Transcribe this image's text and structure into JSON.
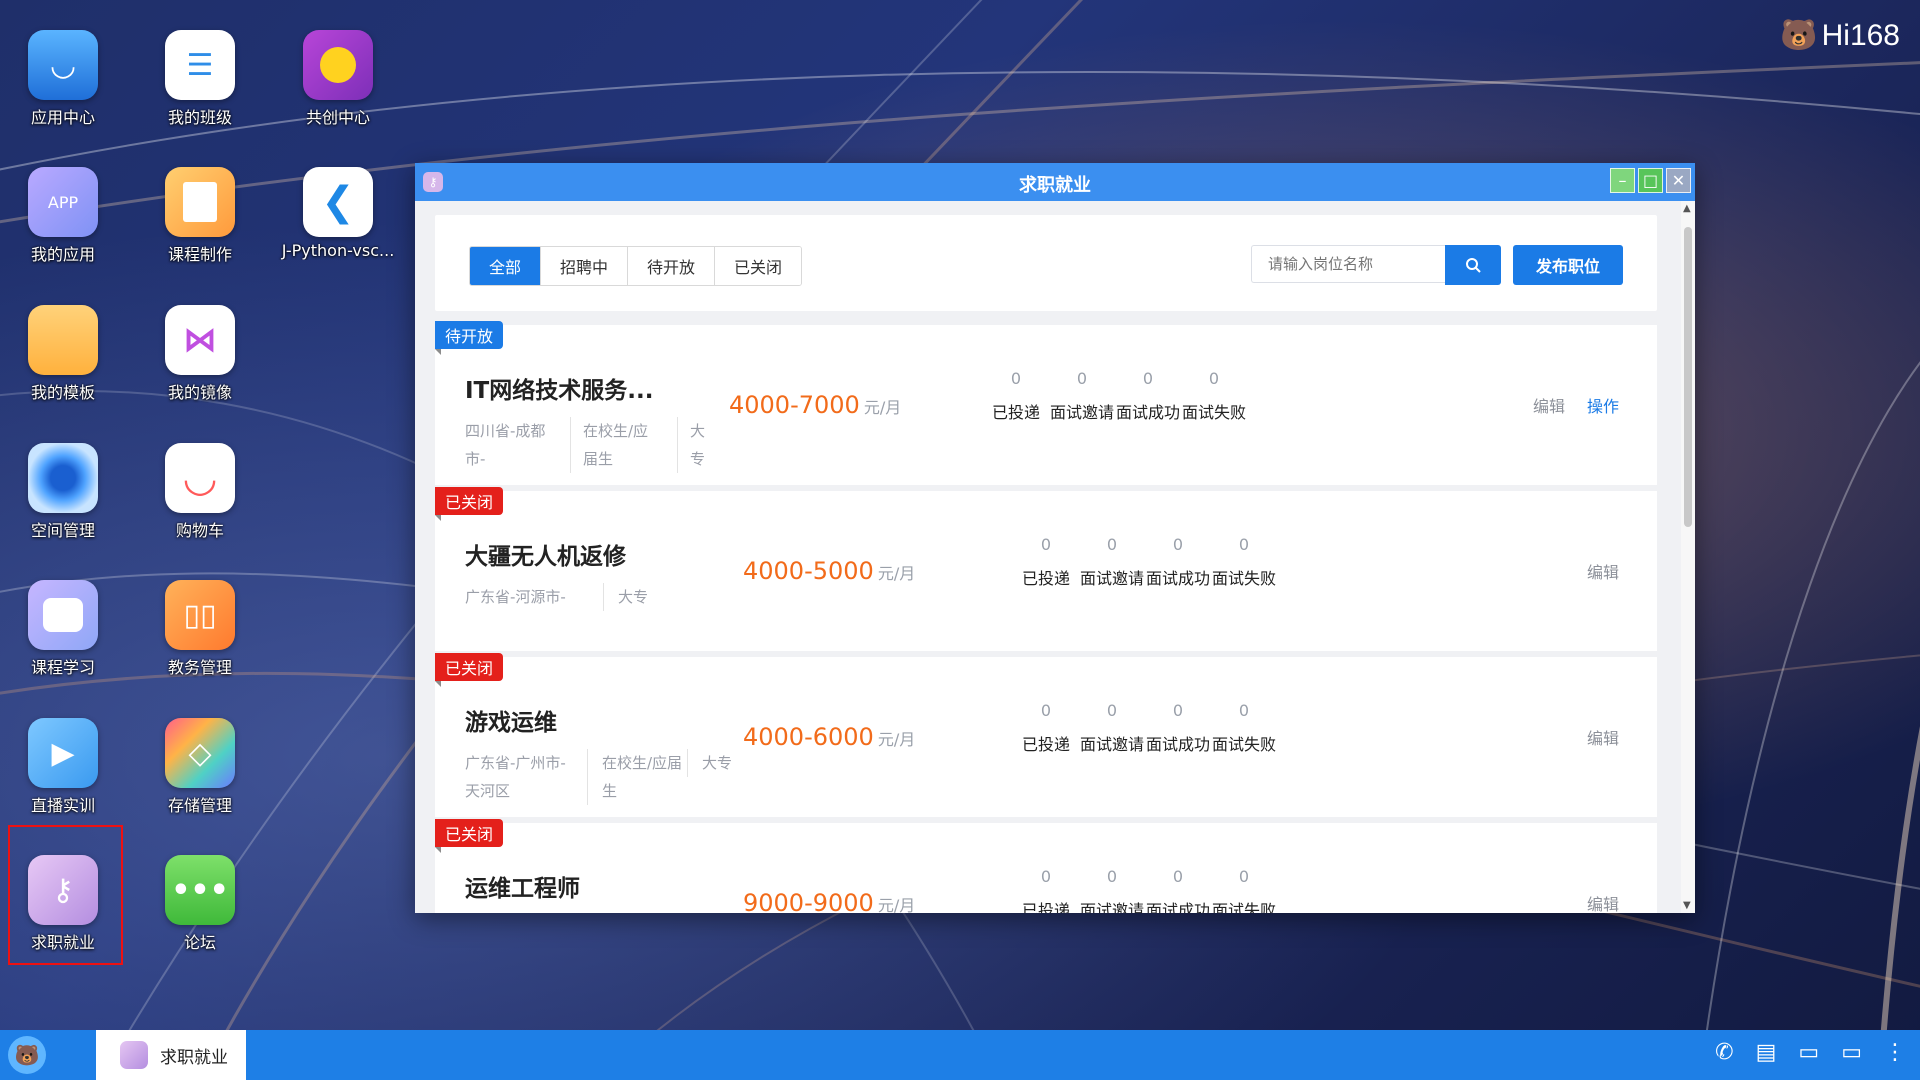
{
  "brand": {
    "text": "Hi168"
  },
  "desktop": {
    "icons": [
      {
        "label": "应用中心"
      },
      {
        "label": "我的班级"
      },
      {
        "label": "共创中心"
      },
      {
        "label": "我的应用",
        "badge": "APP"
      },
      {
        "label": "课程制作"
      },
      {
        "label": "J-Python-vsc..."
      },
      {
        "label": "我的模板"
      },
      {
        "label": "我的镜像"
      },
      {
        "label": "空间管理"
      },
      {
        "label": "购物车"
      },
      {
        "label": "课程学习"
      },
      {
        "label": "教务管理"
      },
      {
        "label": "直播实训"
      },
      {
        "label": "存储管理"
      },
      {
        "label": "求职就业"
      },
      {
        "label": "论坛"
      }
    ]
  },
  "window": {
    "title": "求职就业",
    "tabs": [
      {
        "label": "全部",
        "active": true
      },
      {
        "label": "招聘中",
        "active": false
      },
      {
        "label": "待开放",
        "active": false
      },
      {
        "label": "已关闭",
        "active": false
      }
    ],
    "search": {
      "placeholder": "请输入岗位名称"
    },
    "publish_label": "发布职位",
    "stat_labels": [
      "已投递",
      "面试邀请",
      "面试成功",
      "面试失败"
    ],
    "jobs": [
      {
        "status": "待开放",
        "status_color": "#1b7be6",
        "title": "IT网络技术服务...",
        "location": "四川省-成都市-",
        "identity": "在校生/应届生",
        "education": "大专",
        "salary": "4000-7000",
        "unit": "元/月",
        "stats": [
          "0",
          "0",
          "0",
          "0"
        ],
        "edit": "编辑",
        "op": "操作"
      },
      {
        "status": "已关闭",
        "status_color": "#e4201b",
        "title": "大疆无人机返修",
        "location": "广东省-河源市-",
        "education": "大专",
        "salary": "4000-5000",
        "unit": "元/月",
        "stats": [
          "0",
          "0",
          "0",
          "0"
        ],
        "edit": "编辑"
      },
      {
        "status": "已关闭",
        "status_color": "#e4201b",
        "title": "游戏运维",
        "location": "广东省-广州市-天河区",
        "identity": "在校生/应届生",
        "education": "大专",
        "salary": "4000-6000",
        "unit": "元/月",
        "stats": [
          "0",
          "0",
          "0",
          "0"
        ],
        "edit": "编辑"
      },
      {
        "status": "已关闭",
        "status_color": "#e4201b",
        "title": "运维工程师",
        "salary": "9000-9000",
        "unit": "元/月",
        "stats": [
          "0",
          "0",
          "0",
          "0"
        ],
        "edit": "编辑"
      }
    ]
  },
  "taskbar": {
    "active_app": "求职就业"
  }
}
